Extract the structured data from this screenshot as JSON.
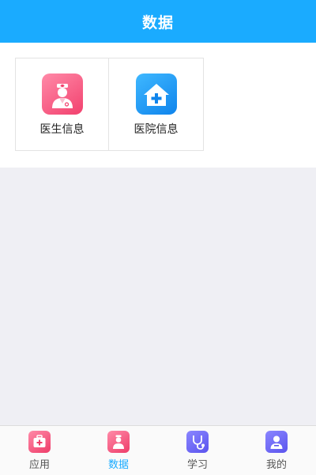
{
  "header": {
    "title": "数据"
  },
  "tiles": [
    {
      "label": "医生信息",
      "icon": "doctor-icon",
      "color": "#f2416e"
    },
    {
      "label": "医院信息",
      "icon": "hospital-icon",
      "color": "#0f84ec"
    }
  ],
  "tabbar": {
    "active_color": "#1aabff",
    "items": [
      {
        "label": "应用",
        "icon": "medical-kit-icon",
        "active": false
      },
      {
        "label": "数据",
        "icon": "doctor-icon",
        "active": true
      },
      {
        "label": "学习",
        "icon": "stethoscope-icon",
        "active": false
      },
      {
        "label": "我的",
        "icon": "profile-icon",
        "active": false
      }
    ]
  }
}
